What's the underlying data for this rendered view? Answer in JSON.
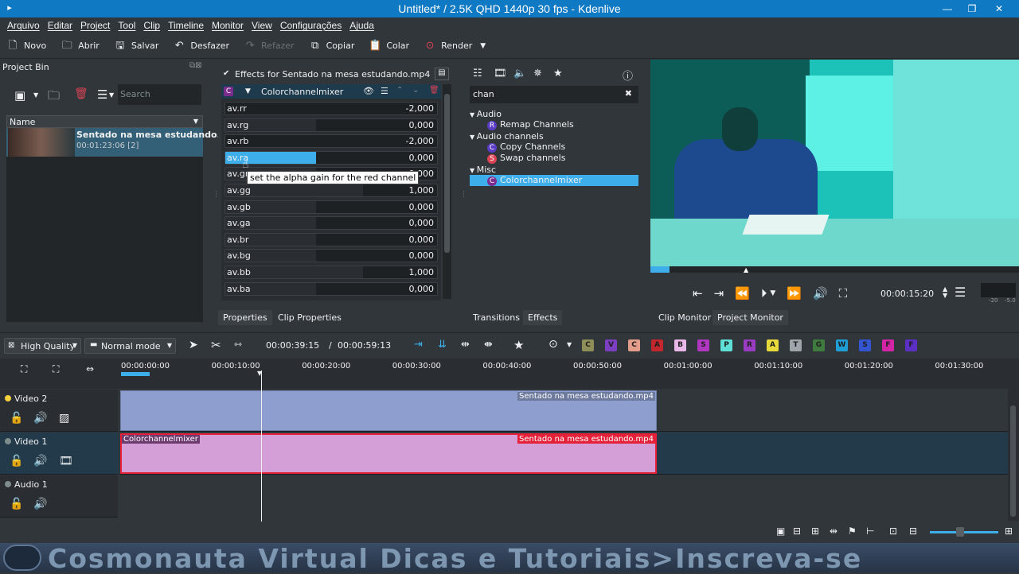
{
  "window": {
    "title": "Untitled* / 2.5K QHD 1440p 30 fps - Kdenlive",
    "controls": [
      "—",
      "❐",
      "✕"
    ]
  },
  "menu": [
    "Arquivo",
    "Editar",
    "Project",
    "Tool",
    "Clip",
    "Timeline",
    "Monitor",
    "View",
    "Configurações",
    "Ajuda"
  ],
  "toolbar": {
    "new": "Novo",
    "open": "Abrir",
    "save": "Salvar",
    "undo": "Desfazer",
    "redo": "Refazer",
    "copy": "Copiar",
    "paste": "Colar",
    "render": "Render"
  },
  "project_bin": {
    "title": "Project Bin",
    "search_placeholder": "Search",
    "column_name": "Name",
    "clip": {
      "name": "Sentado na mesa estudando.m",
      "info": "00:01:23:06  [2]"
    }
  },
  "effect_stack": {
    "header": "Effects for Sentado na mesa estudando.mp4",
    "effect_name": "Colorchannelmixer",
    "effect_badge": "C",
    "params": [
      {
        "name": "av.rr",
        "value": "-2,000",
        "level": 0.0
      },
      {
        "name": "av.rg",
        "value": "0,000",
        "level": 0.43
      },
      {
        "name": "av.rb",
        "value": "-2,000",
        "level": 0.0
      },
      {
        "name": "av.ra",
        "value": "0,000",
        "level": 0.43
      },
      {
        "name": "av.gr",
        "value": "0,000",
        "level": 0.43
      },
      {
        "name": "av.gg",
        "value": "1,000",
        "level": 0.65
      },
      {
        "name": "av.gb",
        "value": "0,000",
        "level": 0.43
      },
      {
        "name": "av.ga",
        "value": "0,000",
        "level": 0.43
      },
      {
        "name": "av.br",
        "value": "0,000",
        "level": 0.43
      },
      {
        "name": "av.bg",
        "value": "0,000",
        "level": 0.43
      },
      {
        "name": "av.bb",
        "value": "1,000",
        "level": 0.65
      },
      {
        "name": "av.ba",
        "value": "0,000",
        "level": 0.43
      }
    ],
    "tooltip": "set the alpha gain for the red channel",
    "tabs": [
      "Properties",
      "Clip Properties"
    ]
  },
  "effects_list": {
    "search_value": "chan",
    "groups": [
      {
        "name": "Audio",
        "items": [
          {
            "name": "Remap Channels",
            "badge": "R",
            "color": "#5b3cc4"
          }
        ]
      },
      {
        "name": "Audio channels",
        "items": [
          {
            "name": "Copy Channels",
            "badge": "C",
            "color": "#5b3cc4"
          },
          {
            "name": "Swap channels",
            "badge": "S",
            "color": "#da4453"
          }
        ]
      },
      {
        "name": "Misc",
        "items": [
          {
            "name": "Colorchannelmixer",
            "badge": "C",
            "color": "#7b2d8e",
            "selected": true
          }
        ]
      }
    ],
    "tabs": [
      "Transitions",
      "Effects"
    ]
  },
  "monitor": {
    "timecode": "00:00:15:20",
    "tabs": [
      "Clip Monitor",
      "Project Monitor"
    ],
    "meter_labels": [
      "-20",
      "-5.0"
    ]
  },
  "timeline_toolbar": {
    "quality": "High Quality",
    "mode": "Normal mode",
    "position": "00:00:39:15",
    "duration": "00:00:59:13",
    "chips": [
      {
        "l": "C",
        "c": "#8e8e58"
      },
      {
        "l": "V",
        "c": "#7d3fc2"
      },
      {
        "l": "C",
        "c": "#e39d8a"
      },
      {
        "l": "A",
        "c": "#c1272d"
      },
      {
        "l": "B",
        "c": "#e9b8e9"
      },
      {
        "l": "S",
        "c": "#b136c0"
      },
      {
        "l": "P",
        "c": "#5fe0d7"
      },
      {
        "l": "R",
        "c": "#9a3cc1"
      },
      {
        "l": "A",
        "c": "#e6d93c"
      },
      {
        "l": "T",
        "c": "#9fa6ab"
      },
      {
        "l": "G",
        "c": "#3f7b3f"
      },
      {
        "l": "W",
        "c": "#1f9fd6"
      },
      {
        "l": "S",
        "c": "#3455d1"
      },
      {
        "l": "F",
        "c": "#d424a6"
      },
      {
        "l": "F",
        "c": "#5b2fc4"
      }
    ]
  },
  "ruler": [
    "00:00:00:00",
    "00:00:10:00",
    "00:00:20:00",
    "00:00:30:00",
    "00:00:40:00",
    "00:00:50:00",
    "00:01:00:00",
    "00:01:10:00",
    "00:01:20:00",
    "00:01:30:00"
  ],
  "tracks": [
    {
      "name": "Video 2",
      "clip_label": "Sentado na mesa estudando.mp4"
    },
    {
      "name": "Video 1",
      "clip_label": "Sentado na mesa estudando.mp4",
      "effect_label": "Colorchannelmixer"
    },
    {
      "name": "Audio 1"
    }
  ],
  "banner": {
    "text": "Cosmonauta Virtual Dicas e Tutoriais>Inscreva-se"
  }
}
